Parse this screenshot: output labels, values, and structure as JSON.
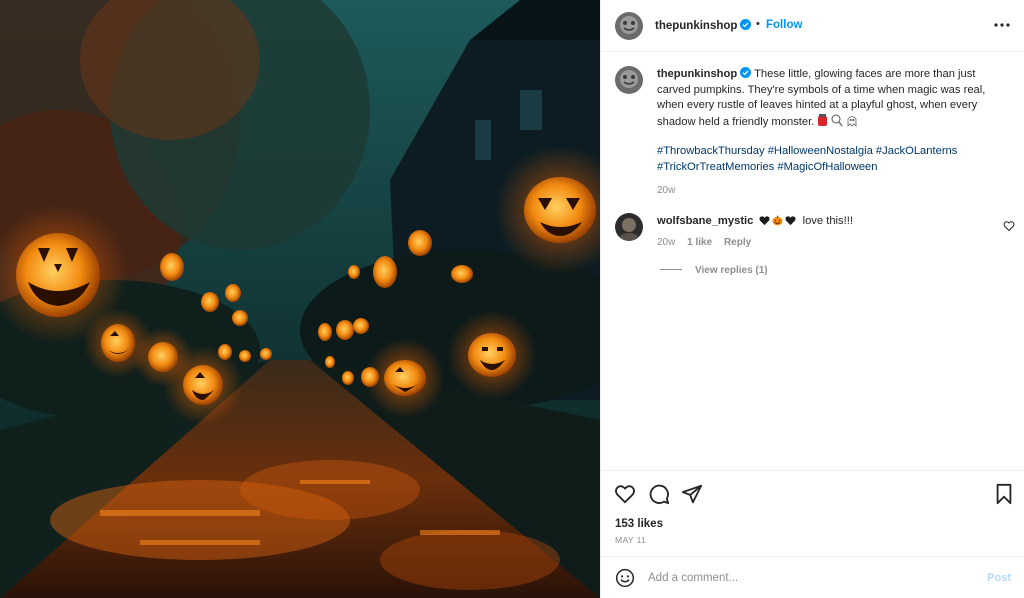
{
  "media": {
    "alt": "Night street lined with glowing carved jack-o'-lanterns"
  },
  "header": {
    "username": "thepunkinshop",
    "verified": true,
    "separator": "•",
    "follow_label": "Follow",
    "more_icon": "more-horizontal-icon"
  },
  "caption": {
    "username": "thepunkinshop",
    "text": "These little, glowing faces are more than just carved pumpkins. They're symbols of a time when magic was real, when every rustle of leaves hinted at a playful ghost, when every shadow held a friendly monster.",
    "emojis": [
      "candy-jar-emoji",
      "lollipop-emoji",
      "ghost-emoji"
    ],
    "hashtags": [
      "#ThrowbackThursday",
      "#HalloweenNostalgia",
      "#JackOLanterns",
      "#TrickOrTreatMemories",
      "#MagicOfHalloween"
    ],
    "age": "20w"
  },
  "comments": [
    {
      "username": "wolfsbane_mystic",
      "emojis": [
        "black-heart-emoji",
        "jack-o-lantern-emoji",
        "black-heart-emoji"
      ],
      "text": "love this!!!",
      "age": "20w",
      "likes": "1 like",
      "reply_label": "Reply",
      "view_replies": "View replies (1)"
    }
  ],
  "actions": {
    "icons": [
      "heart-icon",
      "comment-icon",
      "share-icon",
      "bookmark-icon"
    ],
    "likes": "153 likes",
    "date": "MAY 11"
  },
  "add_comment": {
    "placeholder": "Add a comment...",
    "post_label": "Post"
  },
  "colors": {
    "link_blue": "#0095f6",
    "hashtag_blue": "#00376b",
    "muted": "#8e8e8e",
    "post_disabled": "#b3dbff"
  }
}
